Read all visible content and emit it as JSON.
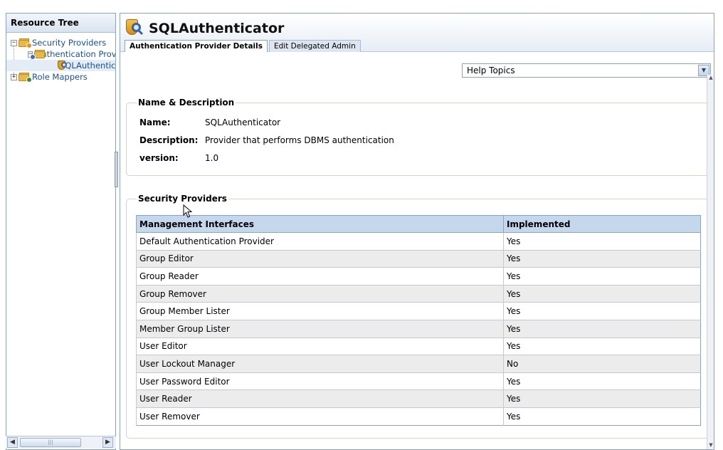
{
  "tree": {
    "header": "Resource Tree",
    "items": [
      {
        "label": "Security Providers",
        "expander": "−",
        "icon": "folder-provider-icon"
      },
      {
        "label": "Authentication Providers",
        "expander": "−",
        "icon": "folder-auth-icon"
      },
      {
        "label": "SQLAuthenticator",
        "icon": "sql-authenticator-icon"
      },
      {
        "label": "Role Mappers",
        "expander": "+",
        "icon": "folder-role-icon"
      }
    ]
  },
  "page": {
    "title": "SQLAuthenticator",
    "tabs": [
      "Authentication Provider Details",
      "Edit Delegated Admin"
    ]
  },
  "help": {
    "selected": "Help Topics"
  },
  "name_description": {
    "legend": "Name & Description",
    "rows": [
      {
        "label": "Name:",
        "value": "SQLAuthenticator"
      },
      {
        "label": "Description:",
        "value": "Provider that performs DBMS authentication"
      },
      {
        "label": "version:",
        "value": "1.0"
      }
    ]
  },
  "security_providers": {
    "legend": "Security Providers",
    "columns": [
      "Management Interfaces",
      "Implemented"
    ],
    "rows": [
      [
        "Default Authentication Provider",
        "Yes"
      ],
      [
        "Group Editor",
        "Yes"
      ],
      [
        "Group Reader",
        "Yes"
      ],
      [
        "Group Remover",
        "Yes"
      ],
      [
        "Group Member Lister",
        "Yes"
      ],
      [
        "Member Group Lister",
        "Yes"
      ],
      [
        "User Editor",
        "Yes"
      ],
      [
        "User Lockout Manager",
        "No"
      ],
      [
        "User Password Editor",
        "Yes"
      ],
      [
        "User Reader",
        "Yes"
      ],
      [
        "User Remover",
        "Yes"
      ]
    ]
  },
  "colors": {
    "header_bg": "#c5d7ed",
    "link": "#1a4f9a",
    "row_alt": "#ececec"
  }
}
